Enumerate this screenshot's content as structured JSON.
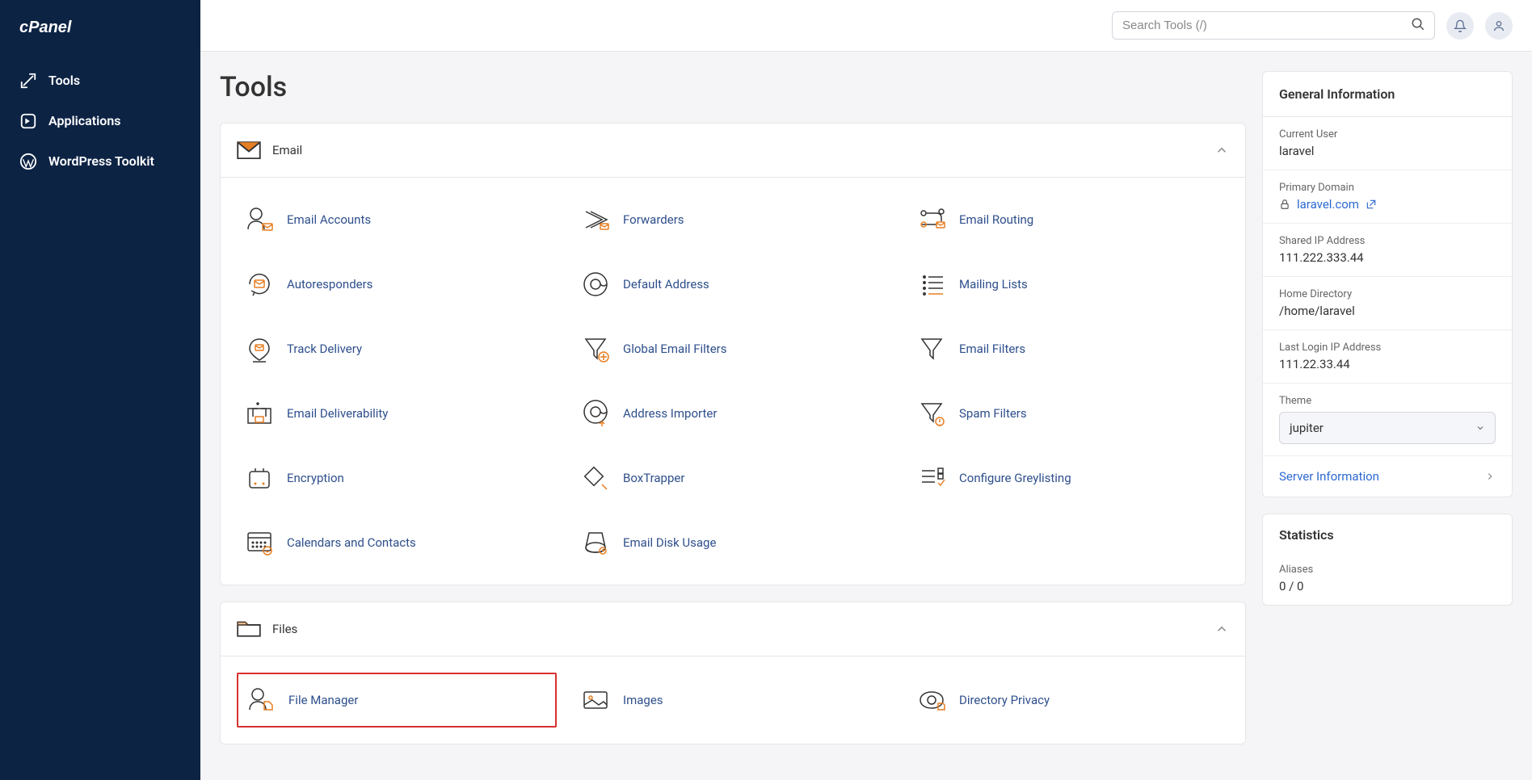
{
  "search_placeholder": "Search Tools (/)",
  "page_title": "Tools",
  "sidebar": {
    "items": [
      {
        "label": "Tools"
      },
      {
        "label": "Applications"
      },
      {
        "label": "WordPress Toolkit"
      }
    ]
  },
  "email_section": {
    "title": "Email",
    "tools": [
      {
        "label": "Email Accounts"
      },
      {
        "label": "Forwarders"
      },
      {
        "label": "Email Routing"
      },
      {
        "label": "Autoresponders"
      },
      {
        "label": "Default Address"
      },
      {
        "label": "Mailing Lists"
      },
      {
        "label": "Track Delivery"
      },
      {
        "label": "Global Email Filters"
      },
      {
        "label": "Email Filters"
      },
      {
        "label": "Email Deliverability"
      },
      {
        "label": "Address Importer"
      },
      {
        "label": "Spam Filters"
      },
      {
        "label": "Encryption"
      },
      {
        "label": "BoxTrapper"
      },
      {
        "label": "Configure Greylisting"
      },
      {
        "label": "Calendars and Contacts"
      },
      {
        "label": "Email Disk Usage"
      }
    ]
  },
  "files_section": {
    "title": "Files",
    "tools": [
      {
        "label": "File Manager"
      },
      {
        "label": "Images"
      },
      {
        "label": "Directory Privacy"
      }
    ]
  },
  "info_panel": {
    "title": "General Information",
    "current_user_label": "Current User",
    "current_user": "laravel",
    "primary_domain_label": "Primary Domain",
    "primary_domain": "laravel.com",
    "shared_ip_label": "Shared IP Address",
    "shared_ip": "111.222.333.44",
    "home_dir_label": "Home Directory",
    "home_dir": "/home/laravel",
    "last_login_label": "Last Login IP Address",
    "last_login": "111.22.33.44",
    "theme_label": "Theme",
    "theme_value": "jupiter",
    "server_info": "Server Information"
  },
  "stats": {
    "title": "Statistics",
    "aliases_label": "Aliases",
    "aliases_value": "0 / 0"
  }
}
